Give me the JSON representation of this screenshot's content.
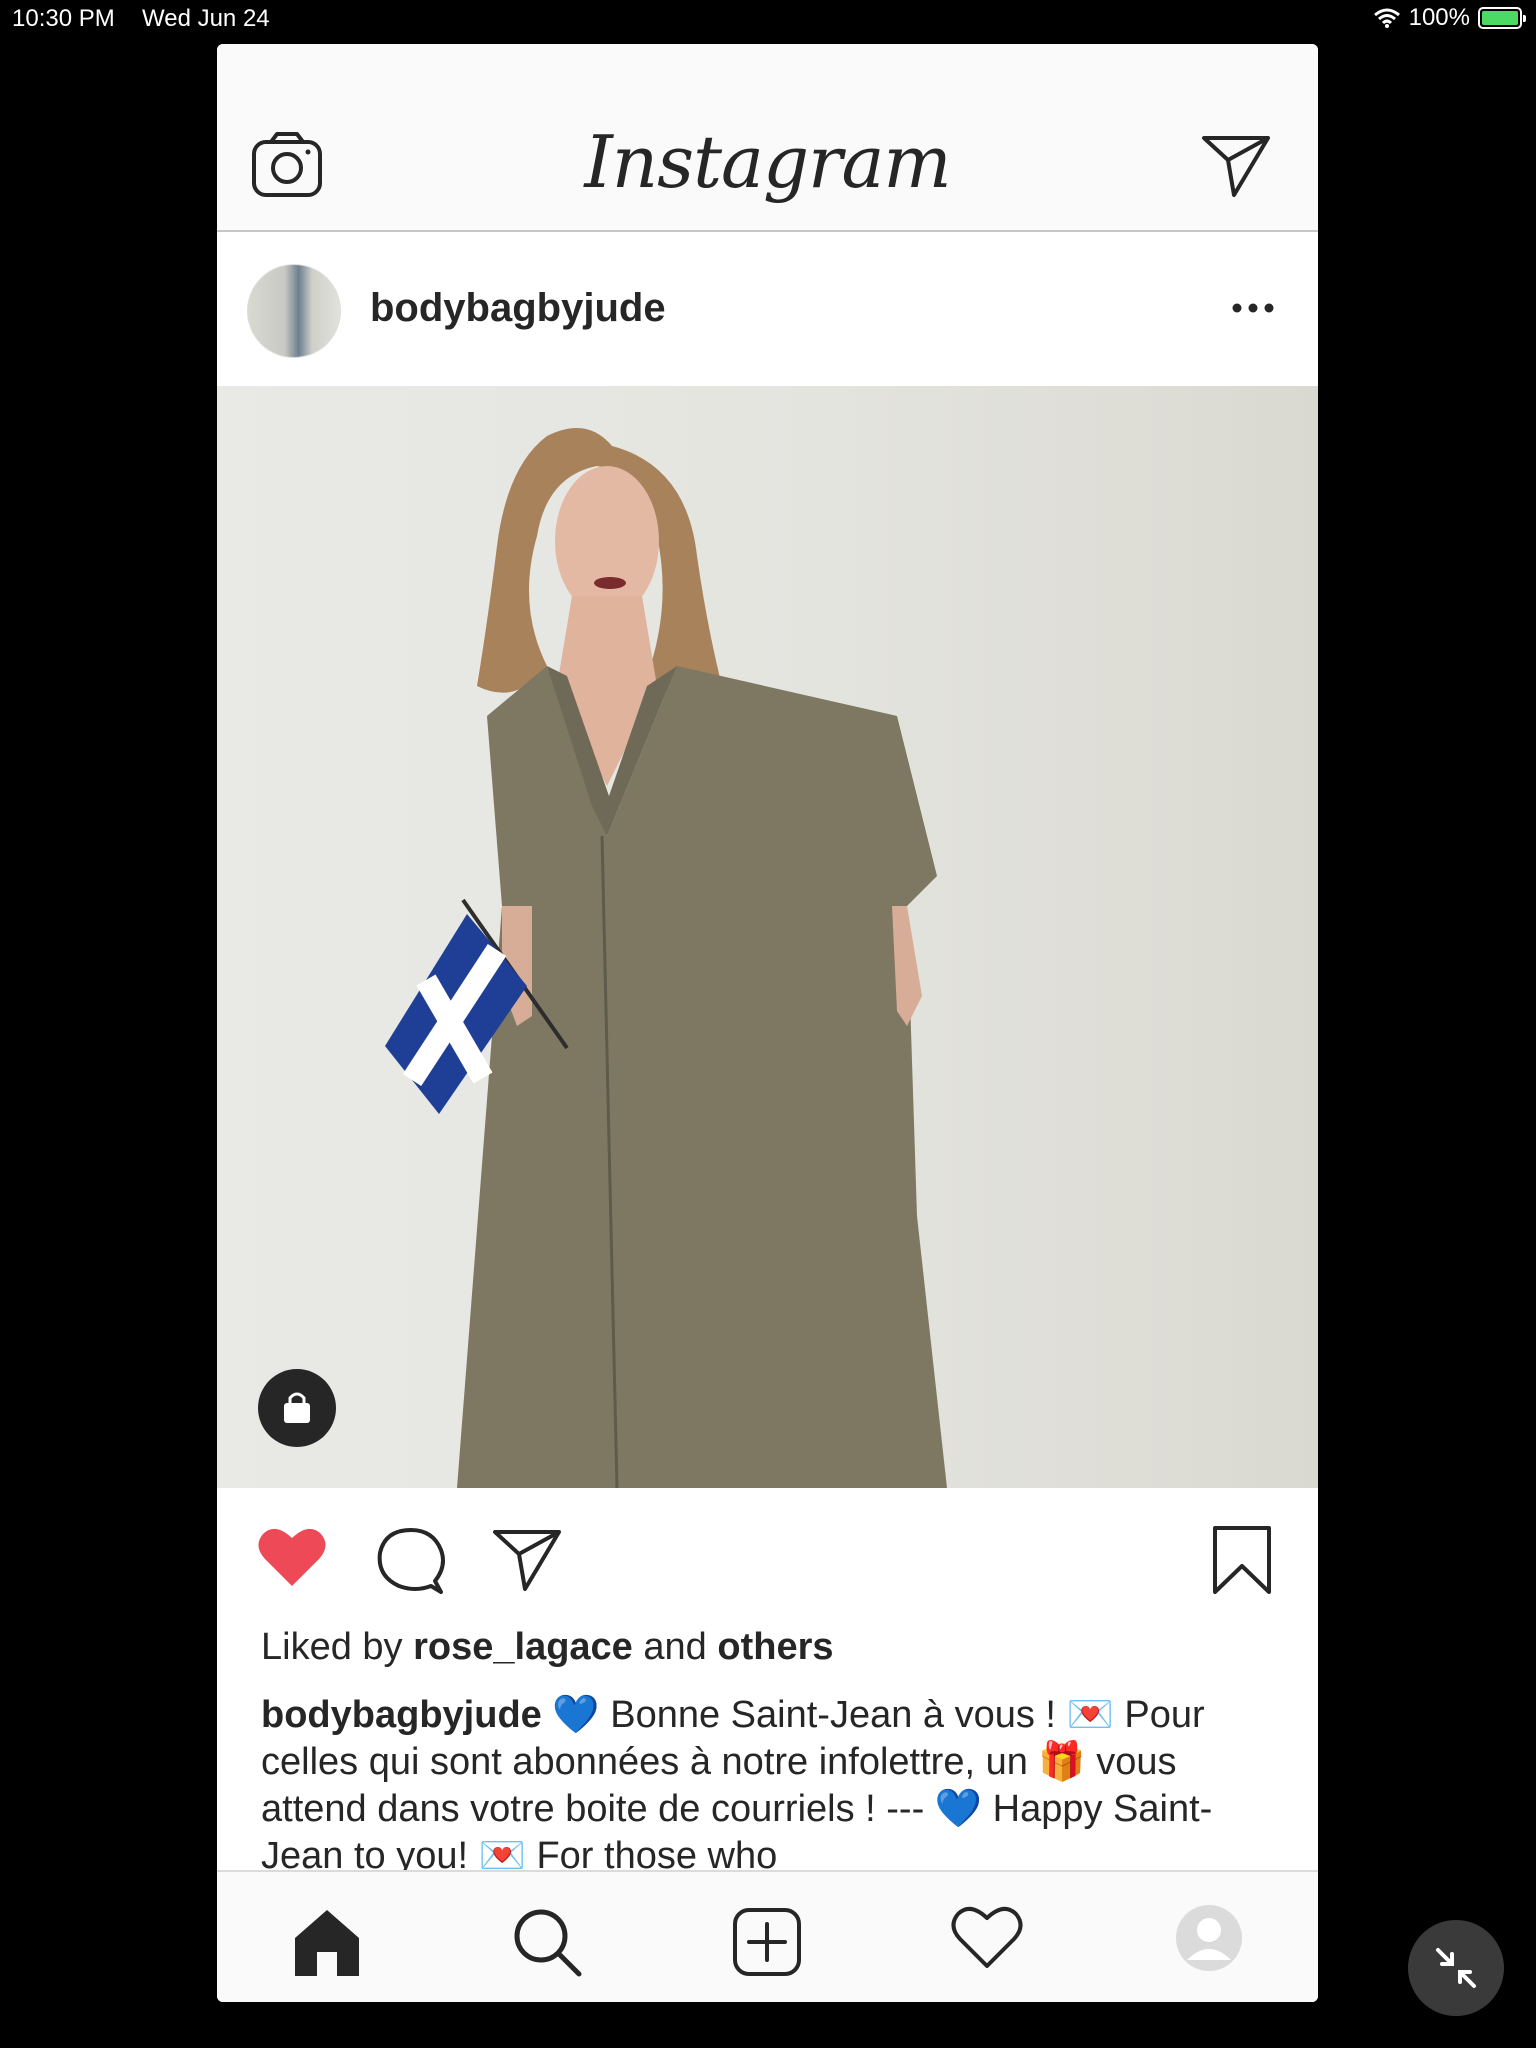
{
  "status_bar": {
    "time": "10:30 PM",
    "date": "Wed Jun 24",
    "battery": "100%",
    "battery_color": "#4cd964"
  },
  "header": {
    "logo_text": "Instagram",
    "camera_icon": "camera-icon",
    "direct_icon": "paper-plane-icon"
  },
  "post": {
    "username": "bodybagbyjude",
    "more_icon": "ellipsis-icon",
    "shop_icon": "shopping-bag-icon",
    "like_color": "#ed4956",
    "liked_by_prefix": "Liked by",
    "liked_by_user": "rose_lagace",
    "liked_by_and": "and",
    "liked_by_others": "others",
    "caption_user": "bodybagbyjude",
    "caption_text": "💙 Bonne Saint-Jean à vous ! 💌 Pour celles qui sont abonnées à notre infolettre, un 🎁 vous attend dans votre boite de courriels ! --- 💙 Happy Saint-Jean to you! 💌 For those who"
  },
  "tabbar": {
    "items": [
      "home-icon",
      "search-icon",
      "new-post-icon",
      "activity-heart-icon",
      "profile-icon"
    ]
  }
}
